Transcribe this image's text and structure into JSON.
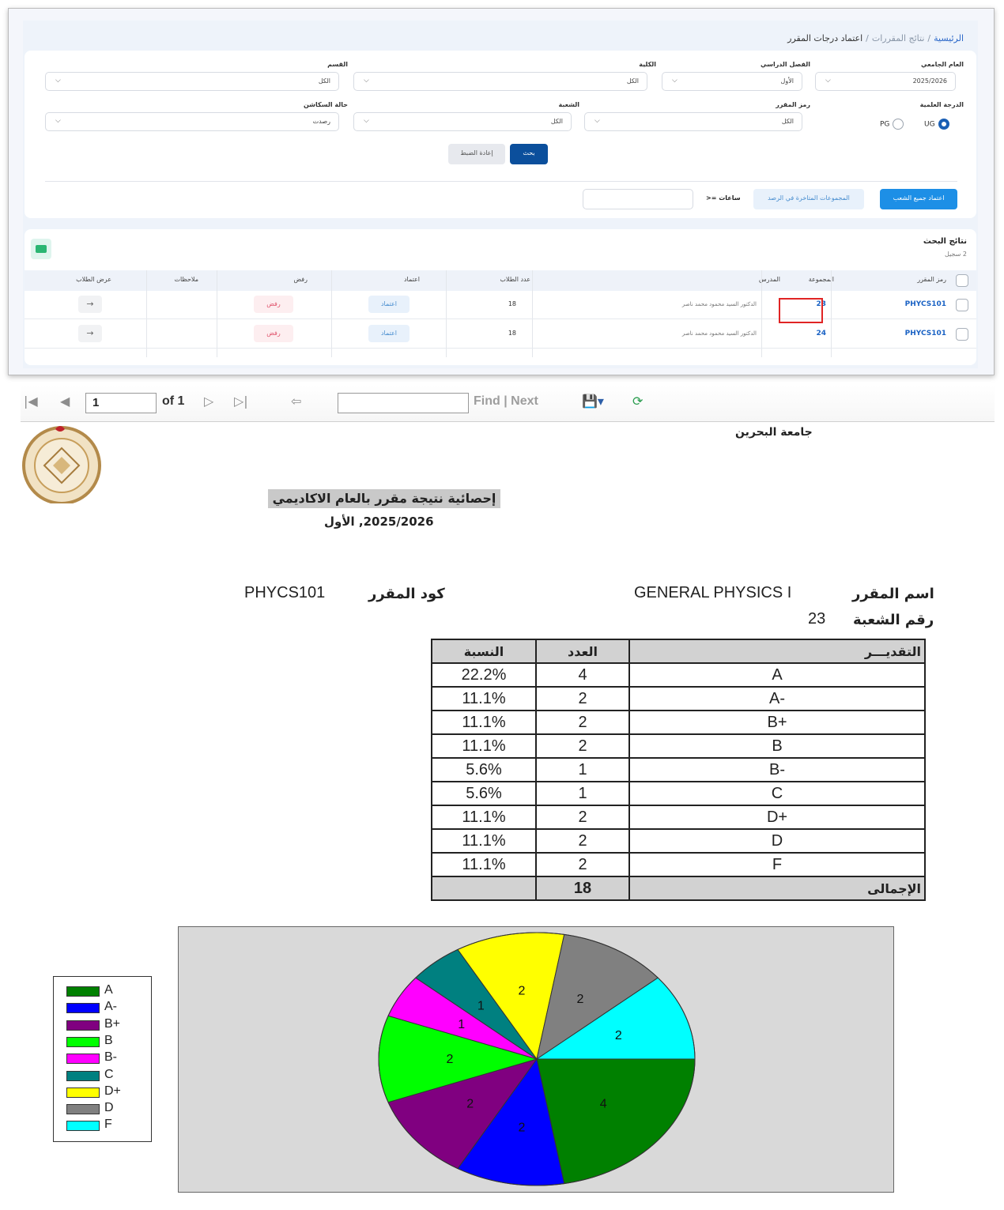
{
  "web": {
    "breadcrumb": {
      "home": "الرئيسية",
      "sep1": "/",
      "mid": "نتائج المقررات",
      "sep2": "/",
      "current": "اعتماد درجات المقرر"
    },
    "filters": {
      "academic_year": {
        "label": "العام الجامعي",
        "value": "2025/2026"
      },
      "semester": {
        "label": "الفصل الدراسي",
        "value": "الأول"
      },
      "college": {
        "label": "الكلية",
        "value": "الكل"
      },
      "department": {
        "label": "القسم",
        "value": "الكل"
      },
      "degree": {
        "label": "الدرجة العلمية",
        "options": [
          "UG",
          "PG"
        ],
        "selected": "UG"
      },
      "course_code": {
        "label": "رمز المقرر",
        "value": "الكل"
      },
      "section": {
        "label": "الشعبة",
        "value": "الكل"
      },
      "status": {
        "label": "حالة السكاشن",
        "value": "رصدت"
      },
      "search_label": "بحث",
      "reset_label": "إعادة الضبط",
      "approve_all_label": "اعتماد جميع الشعب",
      "late_groups_label": "المجموعات المتاخرة في الرصد",
      "hours_label": "ساعات =<"
    },
    "results": {
      "title": "نتائج البحث",
      "count": "2 سجيل",
      "columns": [
        "رمز المقرر",
        "المجموعة",
        "المدرس",
        "عدد الطلاب",
        "اعتماد",
        "رفض",
        "ملاحظات",
        "عرض الطلاب"
      ],
      "rows": [
        {
          "code": "PHYCS101",
          "group": "23",
          "instructor": "الدكتور السيد محمود محمد ناصر",
          "students": "18",
          "approve": "اعتماد",
          "reject": "رفض",
          "view": "→"
        },
        {
          "code": "PHYCS101",
          "group": "24",
          "instructor": "الدكتور السيد محمود محمد ناصر",
          "students": "18",
          "approve": "اعتماد",
          "reject": "رفض",
          "view": "→"
        }
      ]
    }
  },
  "viewer": {
    "page": "1",
    "of_label": "of 1",
    "find_next": "Find | Next"
  },
  "report": {
    "university": "جامعة البحرين",
    "title": "إحصائية نتيجة مقرر بالعام الاكاديمي",
    "year": "2025/2026, الأول",
    "course_name_label": "اسم المقرر",
    "course_name": "GENERAL PHYSICS I",
    "course_code_label": "كود المقرر",
    "course_code": "PHYCS101",
    "section_label": "رقم الشعبة",
    "section": "23",
    "table_headers": {
      "grade": "التقديـــر",
      "count": "العدد",
      "percent": "النسبة"
    },
    "total_label": "الإجمالى",
    "total": "18"
  },
  "chart_data": {
    "type": "pie",
    "categories": [
      "A",
      "A-",
      "B+",
      "B",
      "B-",
      "C",
      "D+",
      "D",
      "F"
    ],
    "values": [
      4,
      2,
      2,
      2,
      1,
      1,
      2,
      2,
      2
    ],
    "percentages": [
      "22.2%",
      "11.1%",
      "11.1%",
      "11.1%",
      "5.6%",
      "5.6%",
      "11.1%",
      "11.1%",
      "11.1%"
    ],
    "colors": [
      "#008000",
      "#0000ff",
      "#800080",
      "#00ff00",
      "#ff00ff",
      "#008080",
      "#ffff00",
      "#808080",
      "#00ffff"
    ],
    "legend_position": "left"
  }
}
